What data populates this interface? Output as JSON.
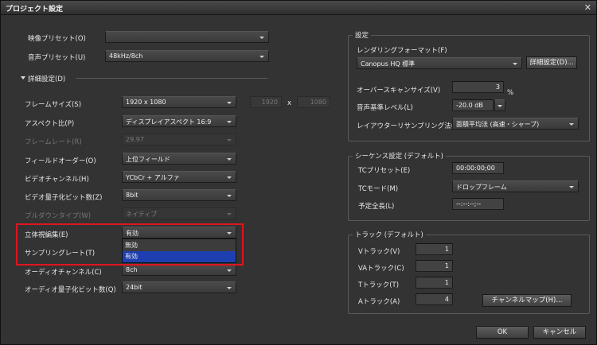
{
  "window": {
    "title": "プロジェクト設定"
  },
  "left": {
    "video_preset_label": "映像プリセット(O)",
    "video_preset_value": "",
    "audio_preset_label": "音声プリセット(U)",
    "audio_preset_value": "48kHz/8ch",
    "details_label": "詳細設定(D)",
    "frame_size_label": "フレームサイズ(S)",
    "frame_size_value": "1920 x 1080",
    "frame_w": "1920",
    "frame_x": "x",
    "frame_h": "1080",
    "aspect_label": "アスペクト比(P)",
    "aspect_value": "ディスプレイアスペクト 16:9",
    "framerate_label": "フレームレート(R)",
    "framerate_value": "29.97",
    "field_label": "フィールドオーダー(O)",
    "field_value": "上位フィールド",
    "video_channel_label": "ビデオチャンネル(H)",
    "video_channel_value": "YCbCr + アルファ",
    "video_bit_label": "ビデオ量子化ビット数(Z)",
    "video_bit_value": "8bit",
    "pulldown_label": "プルダウンタイプ(W)",
    "pulldown_value": "ネイティブ",
    "stereo_label": "立体視編集(E)",
    "stereo_value": "有効",
    "stereo_options": [
      "無効",
      "有効"
    ],
    "sampling_label": "サンプリングレート(T)",
    "audio_channel_label": "オーディオチャンネル(C)",
    "audio_channel_value": "8ch",
    "audio_bit_label": "オーディオ量子化ビット数(Q)",
    "audio_bit_value": "24bit"
  },
  "settings": {
    "group_title": "設定",
    "rendering_label": "レンダリングフォーマット(F)",
    "rendering_value": "Canopus HQ 標準",
    "detail_button": "詳細設定(D)...",
    "overscan_label": "オーバースキャンサイズ(V)",
    "overscan_value": "3",
    "overscan_unit": "%",
    "audio_level_label": "音声基準レベル(L)",
    "audio_level_value": "-20.0 dB",
    "layouter_label": "レイアウターリサンプリング法(R)",
    "layouter_value": "面積平均法 (高速・シャープ)"
  },
  "sequence": {
    "group_title": "シーケンス設定 (デフォルト)",
    "tc_preset_label": "TCプリセット(E)",
    "tc_preset_value": "00:00:00;00",
    "tc_mode_label": "TCモード(M)",
    "tc_mode_value": "ドロップフレーム",
    "total_length_label": "予定全長(L)",
    "total_length_value": "--:--:--;--"
  },
  "track": {
    "group_title": "トラック (デフォルト)",
    "v_label": "Vトラック(V)",
    "v_value": "1",
    "va_label": "VAトラック(C)",
    "va_value": "1",
    "t_label": "Tトラック(T)",
    "t_value": "1",
    "a_label": "Aトラック(A)",
    "a_value": "4",
    "channel_map_button": "チャンネルマップ(H)..."
  },
  "footer": {
    "ok_button": "OK",
    "cancel_button": "キャンセル"
  },
  "colors": {
    "highlight": "#e0141e",
    "selection": "#1e3fb0"
  }
}
